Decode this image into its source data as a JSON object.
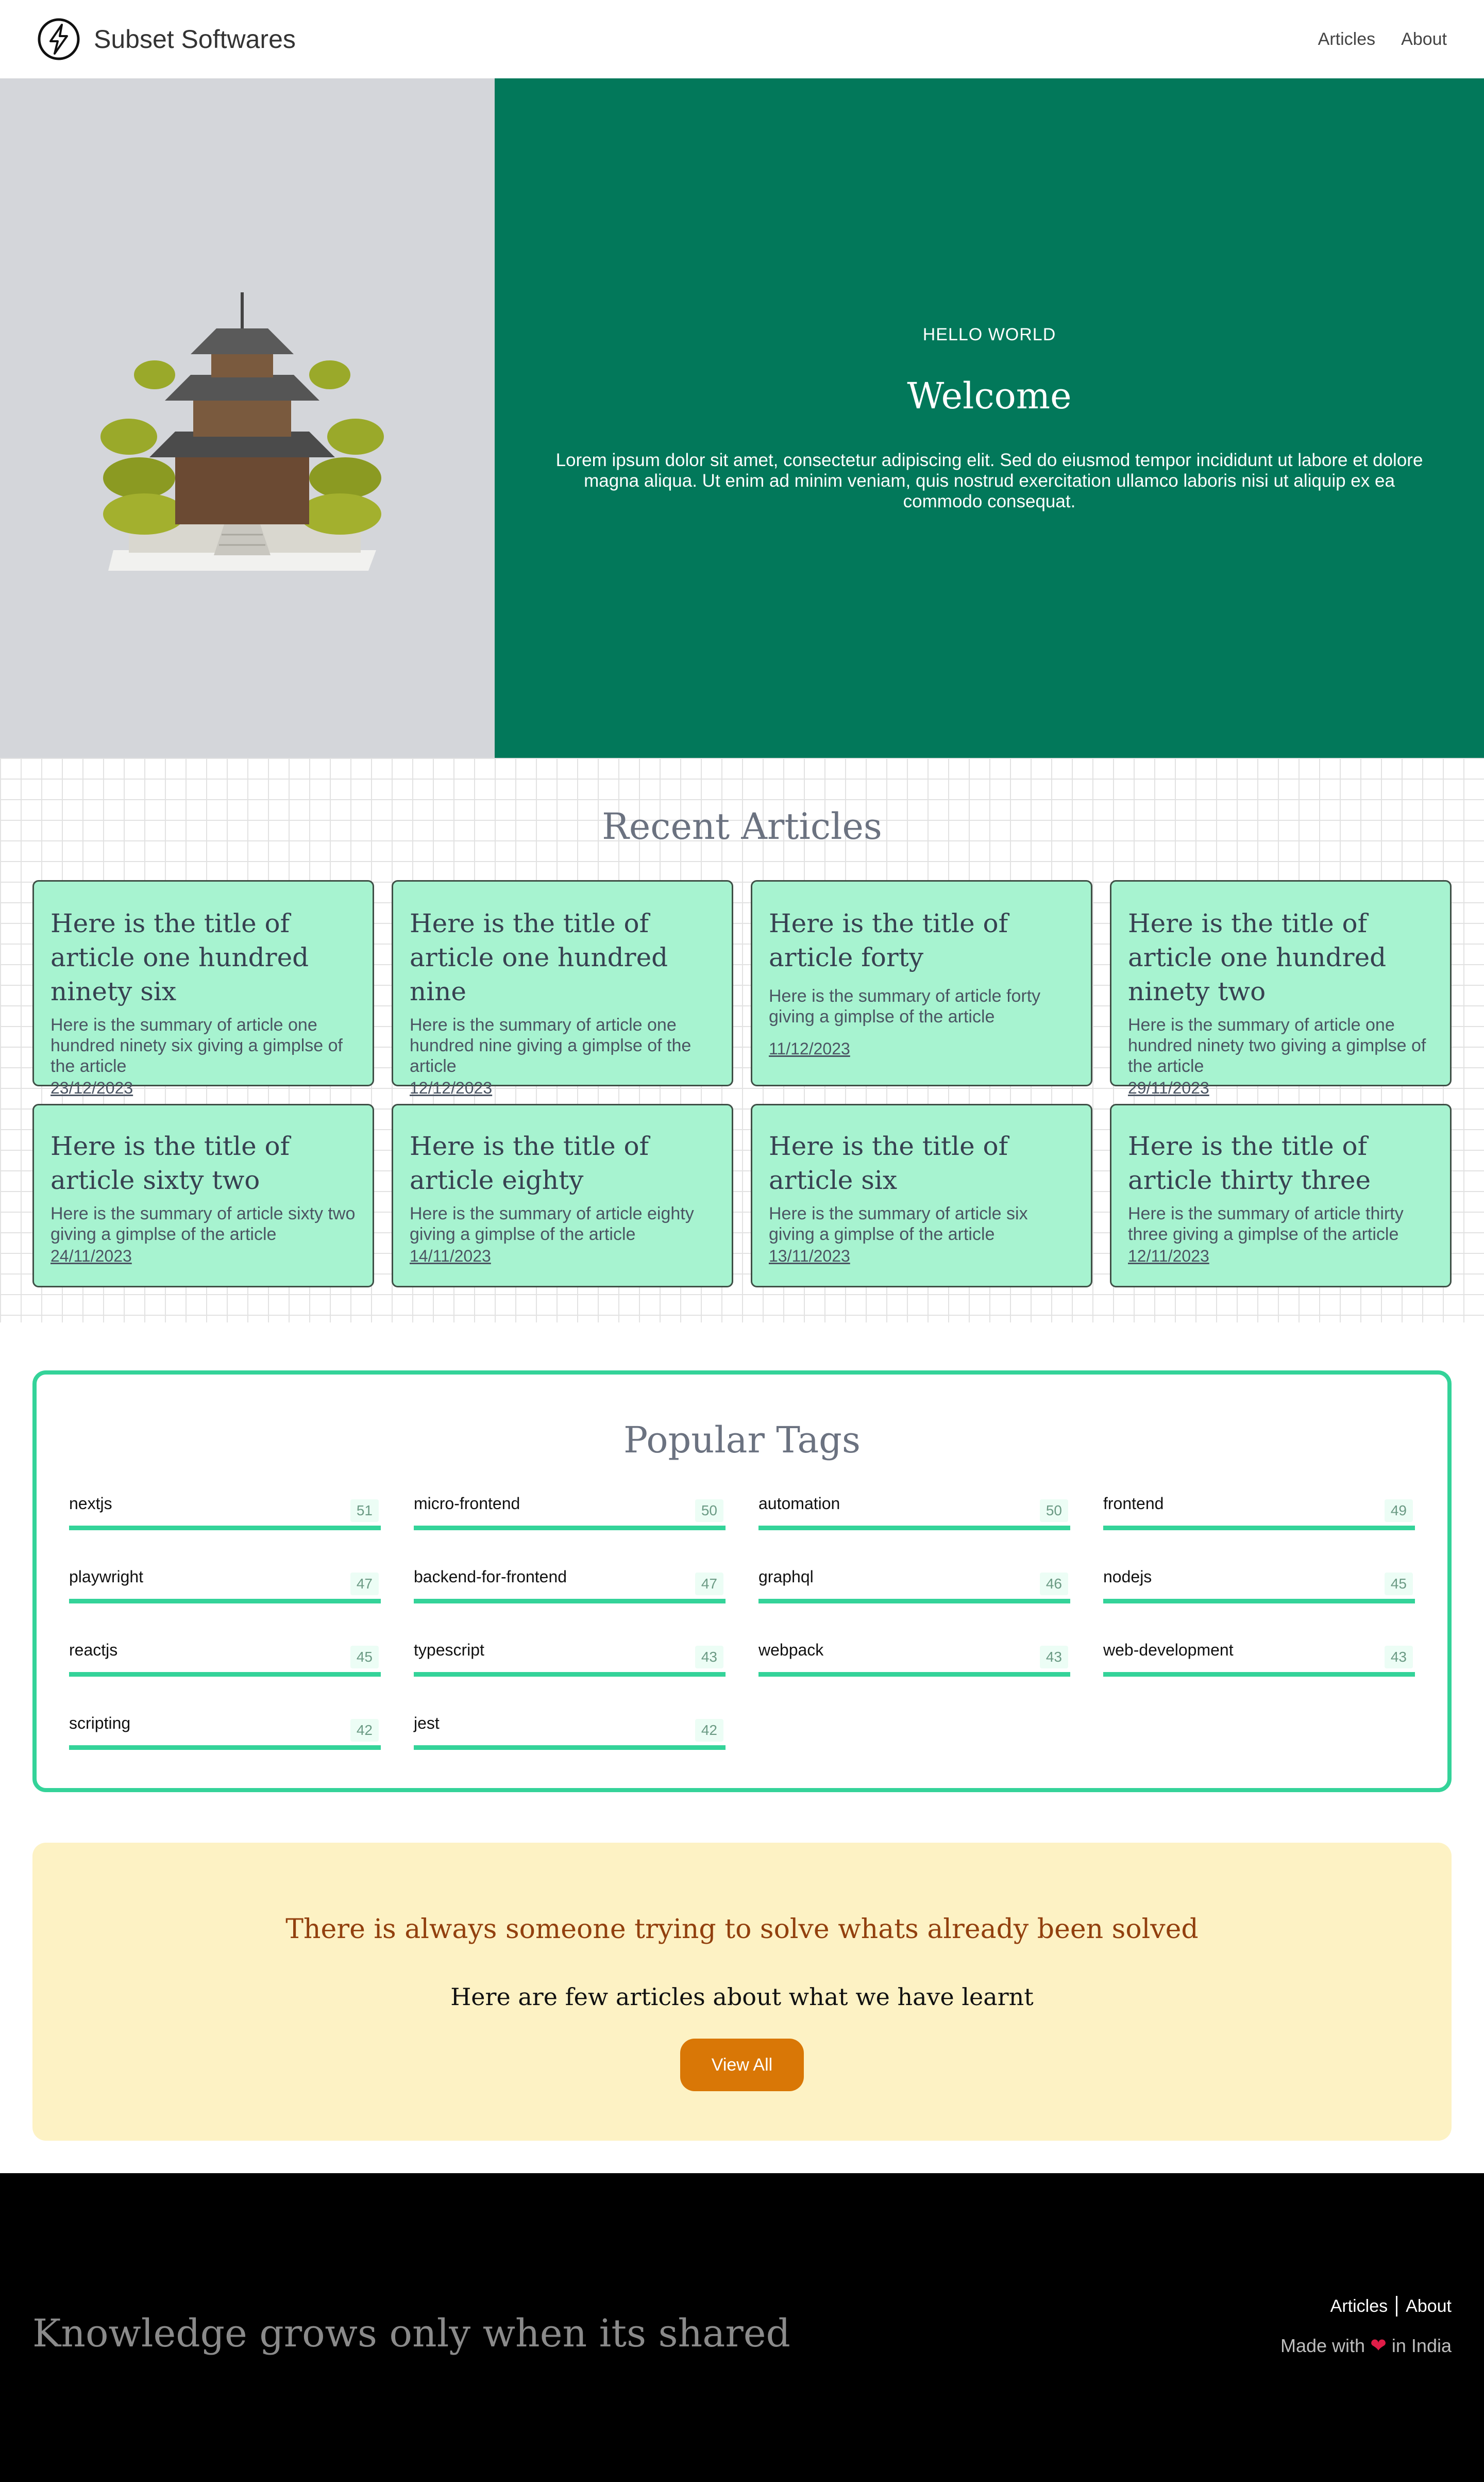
{
  "header": {
    "brand": "Subset Softwares",
    "nav": [
      {
        "label": "Articles"
      },
      {
        "label": "About"
      }
    ]
  },
  "hero": {
    "kicker": "HELLO WORLD",
    "title": "Welcome",
    "text": "Lorem ipsum dolor sit amet, consectetur adipiscing elit. Sed do eiusmod tempor incididunt ut labore et dolore magna aliqua. Ut enim ad minim veniam, quis nostrud exercitation ullamco laboris nisi ut aliquip ex ea commodo consequat."
  },
  "recent": {
    "title": "Recent Articles",
    "articles": [
      {
        "title": "Here is the title of article one hundred ninety six",
        "summary": "Here is the summary of article one hundred ninety six giving a gimplse of the article",
        "date": "23/12/2023"
      },
      {
        "title": "Here is the title of article one hundred nine",
        "summary": "Here is the summary of article one hundred nine giving a gimplse of the article",
        "date": "12/12/2023"
      },
      {
        "title": "Here is the title of article forty",
        "summary": "Here is the summary of article forty giving a gimplse of the article",
        "date": "11/12/2023"
      },
      {
        "title": "Here is the title of article one hundred ninety two",
        "summary": "Here is the summary of article one hundred ninety two giving a gimplse of the article",
        "date": "29/11/2023"
      },
      {
        "title": "Here is the title of article sixty two",
        "summary": "Here is the summary of article sixty two giving a gimplse of the article",
        "date": "24/11/2023"
      },
      {
        "title": "Here is the title of article eighty",
        "summary": "Here is the summary of article eighty giving a gimplse of the article",
        "date": "14/11/2023"
      },
      {
        "title": "Here is the title of article six",
        "summary": "Here is the summary of article six giving a gimplse of the article",
        "date": "13/11/2023"
      },
      {
        "title": "Here is the title of article thirty three",
        "summary": "Here is the summary of article thirty three giving a gimplse of the article",
        "date": "12/11/2023"
      }
    ]
  },
  "tags": {
    "title": "Popular Tags",
    "items": [
      {
        "name": "nextjs",
        "count": "51"
      },
      {
        "name": "micro-frontend",
        "count": "50"
      },
      {
        "name": "automation",
        "count": "50"
      },
      {
        "name": "frontend",
        "count": "49"
      },
      {
        "name": "playwright",
        "count": "47"
      },
      {
        "name": "backend-for-frontend",
        "count": "47"
      },
      {
        "name": "graphql",
        "count": "46"
      },
      {
        "name": "nodejs",
        "count": "45"
      },
      {
        "name": "reactjs",
        "count": "45"
      },
      {
        "name": "typescript",
        "count": "43"
      },
      {
        "name": "webpack",
        "count": "43"
      },
      {
        "name": "web-development",
        "count": "43"
      },
      {
        "name": "scripting",
        "count": "42"
      },
      {
        "name": "jest",
        "count": "42"
      }
    ]
  },
  "cta": {
    "title": "There is always someone trying to solve whats already been solved",
    "subtitle": "Here are few articles about what we have learnt",
    "button": "View All"
  },
  "footer": {
    "tagline": "Knowledge grows only when its shared",
    "links": [
      {
        "label": "Articles"
      },
      {
        "label": "About"
      }
    ],
    "made_prefix": "Made with",
    "made_suffix": "in India"
  },
  "icons": {
    "logo": "lightning-bolt-circle-icon",
    "hero_image": "pagoda-temple-image",
    "heart": "heart-icon"
  },
  "colors": {
    "hero_green": "#02785a",
    "card_mint": "#a7f3d0",
    "tag_accent": "#34d399",
    "cta_bg": "#fdf2c4",
    "cta_button": "#d97706",
    "cta_title": "#92400e"
  }
}
